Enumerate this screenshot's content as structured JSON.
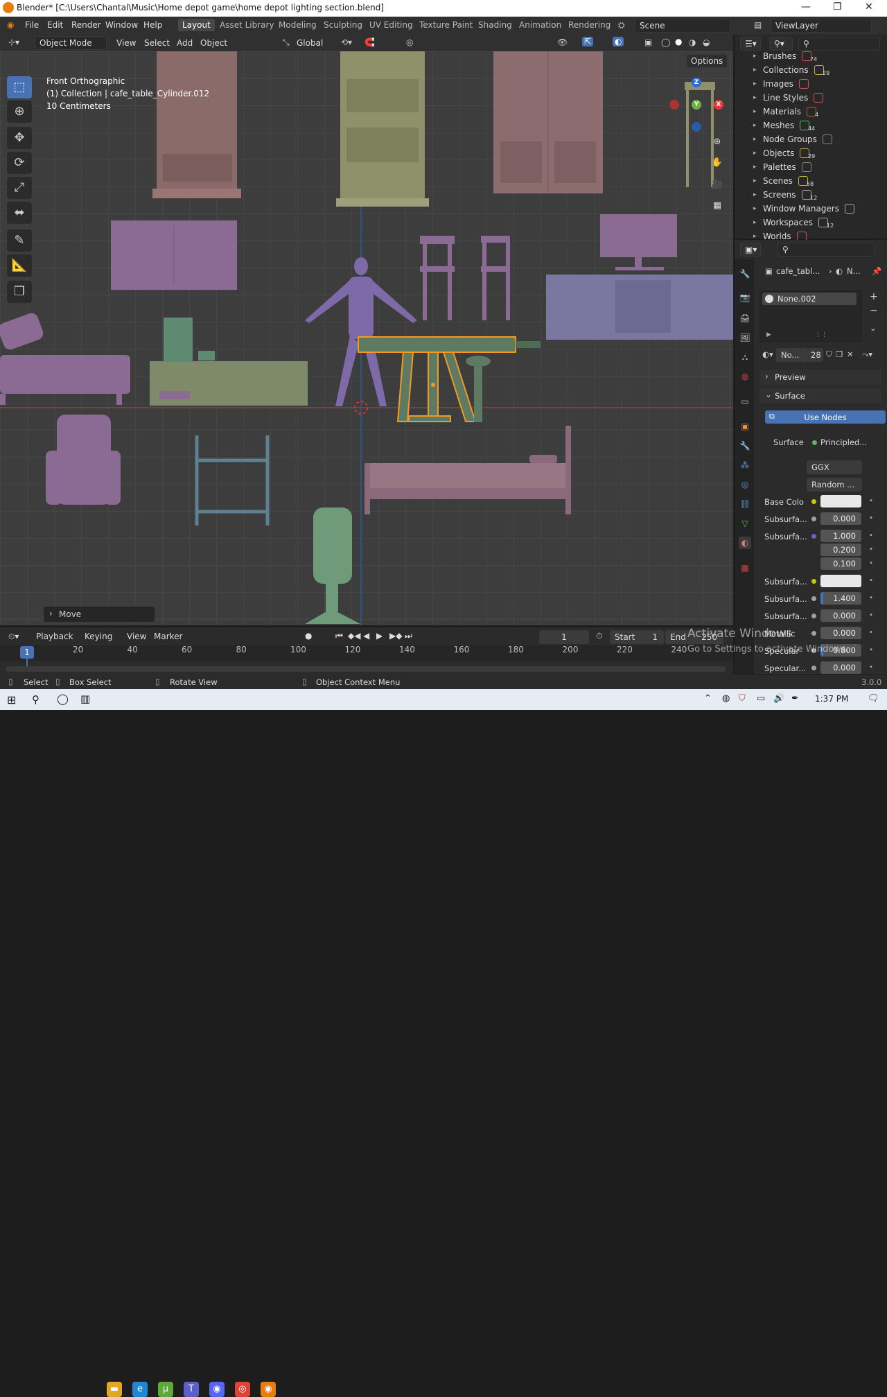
{
  "window": {
    "title": "Blender* [C:\\Users\\Chantal\\Music\\Home depot game\\home depot lighting section.blend]",
    "min": "—",
    "max": "❐",
    "close": "✕"
  },
  "menu": [
    "File",
    "Edit",
    "Render",
    "Window",
    "Help"
  ],
  "workspaces": [
    "Layout",
    "Asset Library",
    "Modeling",
    "Sculpting",
    "UV Editing",
    "Texture Paint",
    "Shading",
    "Animation",
    "Rendering"
  ],
  "scene": "Scene",
  "viewlayer": "ViewLayer",
  "viewport_header": {
    "mode": "Object Mode",
    "view": "View",
    "select": "Select",
    "add": "Add",
    "object": "Object",
    "orientation": "Global",
    "options": "Options"
  },
  "overlay": {
    "view_name": "Front Orthographic",
    "object": "(1) Collection | cafe_table_Cylinder.012",
    "scale": "10 Centimeters"
  },
  "gizmo": {
    "z": "Z",
    "y": "Y",
    "x": "X"
  },
  "last_op": "Move",
  "outliner": [
    {
      "label": "Brushes",
      "count": "74"
    },
    {
      "label": "Collections",
      "count": "29"
    },
    {
      "label": "Images",
      "count": ""
    },
    {
      "label": "Line Styles",
      "count": ""
    },
    {
      "label": "Materials",
      "count": "4"
    },
    {
      "label": "Meshes",
      "count": "44"
    },
    {
      "label": "Node Groups",
      "count": ""
    },
    {
      "label": "Objects",
      "count": "29"
    },
    {
      "label": "Palettes",
      "count": ""
    },
    {
      "label": "Scenes",
      "count": "58"
    },
    {
      "label": "Screens",
      "count": "12"
    },
    {
      "label": "Window Managers",
      "count": ""
    },
    {
      "label": "Workspaces",
      "count": "12"
    },
    {
      "label": "Worlds",
      "count": ""
    }
  ],
  "props": {
    "breadcrumb": "cafe_tabl...",
    "breadcrumb2": "N...",
    "material_slot": "None.002",
    "mat_name": "No...",
    "users": "28",
    "preview": "Preview",
    "surface": "Surface",
    "use_nodes": "Use Nodes",
    "surface_label": "Surface",
    "surface_value": "Principled...",
    "distribution": "GGX",
    "subsurface_method": "Random ...",
    "rows": [
      {
        "label": "Base Colo",
        "value": "",
        "dot": "#c8c800",
        "white": true
      },
      {
        "label": "Subsurfa...",
        "value": "0.000",
        "dot": "#a1a1a1"
      },
      {
        "label": "Subsurfa...",
        "value": "1.000",
        "dot": "#6363c7"
      },
      {
        "label": "",
        "value": "0.200",
        "dot": ""
      },
      {
        "label": "",
        "value": "0.100",
        "dot": ""
      },
      {
        "label": "Subsurfa...",
        "value": "",
        "dot": "#c8c800",
        "white": true
      },
      {
        "label": "Subsurfa...",
        "value": "1.400",
        "dot": "#a1a1a1",
        "bar": true
      },
      {
        "label": "Subsurfa...",
        "value": "0.000",
        "dot": "#a1a1a1"
      },
      {
        "label": "Metallic",
        "value": "0.000",
        "dot": "#a1a1a1"
      },
      {
        "label": "Specular",
        "value": "0.800",
        "dot": "#a1a1a1",
        "bar": true
      },
      {
        "label": "Specular...",
        "value": "0.000",
        "dot": "#a1a1a1"
      }
    ]
  },
  "timeline": {
    "playback": "Playback",
    "keying": "Keying",
    "view": "View",
    "marker": "Marker",
    "frame": "1",
    "start_label": "Start",
    "start": "1",
    "end_label": "End",
    "end": "250",
    "current": "1",
    "ticks": [
      "20",
      "40",
      "60",
      "80",
      "100",
      "120",
      "140",
      "160",
      "180",
      "200",
      "220",
      "240"
    ]
  },
  "status": {
    "select": "Select",
    "box_select": "Box Select",
    "rotate": "Rotate View",
    "context": "Object Context Menu",
    "version": "3.0.0"
  },
  "watermark": {
    "line1": "Activate Windows",
    "line2": "Go to Settings to activate Windows."
  },
  "taskbar": {
    "time": "1:37 PM"
  }
}
